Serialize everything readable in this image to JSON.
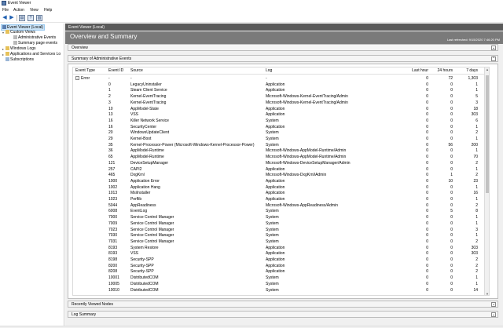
{
  "window": {
    "title": "Event Viewer"
  },
  "menu": [
    "File",
    "Action",
    "View",
    "Help"
  ],
  "tree": {
    "root": "Event Viewer (Local)",
    "custom_views": "Custom Views",
    "admin_events": "Administrative Events",
    "summary_events": "Summary page events",
    "windows_logs": "Windows Logs",
    "apps_services": "Applications and Services Lo",
    "subscriptions": "Subscriptions"
  },
  "main": {
    "header": "Event Viewer (Local)",
    "title": "Overview and Summary",
    "last_refreshed": "Last refreshed: 9/15/2020 7:46:20 PM",
    "sections": {
      "overview": "Overview",
      "admin_summary": "Summary of Administrative Events",
      "recent_nodes": "Recently Viewed Nodes",
      "log_summary": "Log Summary"
    }
  },
  "table": {
    "columns": {
      "type": "Event Type",
      "id": "Event ID",
      "source": "Source",
      "log": "Log",
      "last_hour": "Last hour",
      "h24": "24 hours",
      "d7": "7 days"
    },
    "group_row": {
      "expander": "−",
      "type": "Error",
      "id": "-",
      "source": "-",
      "log": "-",
      "last_hour": "0",
      "h24": "72",
      "d7": "1,303"
    },
    "rows": [
      [
        "0",
        "LegacyUninstaller",
        "Application",
        "0",
        "0",
        "1"
      ],
      [
        "1",
        "Steam Client Service",
        "Application",
        "0",
        "0",
        "1"
      ],
      [
        "2",
        "Kernel-EventTracing",
        "Microsoft-Windows-Kernel-EventTracing/Admin",
        "0",
        "0",
        "5"
      ],
      [
        "3",
        "Kernel-EventTracing",
        "Microsoft-Windows-Kernel-EventTracing/Admin",
        "0",
        "0",
        "3"
      ],
      [
        "10",
        "AppModel-State",
        "Application",
        "0",
        "0",
        "18"
      ],
      [
        "13",
        "VSS",
        "Application",
        "0",
        "0",
        "303"
      ],
      [
        "16",
        "Killer Network Service",
        "System",
        "0",
        "0",
        "6"
      ],
      [
        "16",
        "SecurityCenter",
        "Application",
        "0",
        "0",
        "1"
      ],
      [
        "20",
        "WindowsUpdateClient",
        "System",
        "0",
        "0",
        "2"
      ],
      [
        "29",
        "Kernel-Boot",
        "System",
        "0",
        "0",
        "1"
      ],
      [
        "35",
        "Kernel-Processor-Power (Microsoft-Windows-Kernel-Processor-Power)",
        "System",
        "0",
        "56",
        "200"
      ],
      [
        "36",
        "AppModel-Runtime",
        "Microsoft-Windows-AppModel-Runtime/Admin",
        "0",
        "0",
        "1"
      ],
      [
        "65",
        "AppModel-Runtime",
        "Microsoft-Windows-AppModel-Runtime/Admin",
        "0",
        "0",
        "70"
      ],
      [
        "121",
        "DeviceSetupManager",
        "Microsoft-Windows-DeviceSetupManager/Admin",
        "0",
        "0",
        "2"
      ],
      [
        "257",
        "CAPI2",
        "Application",
        "0",
        "0",
        "1"
      ],
      [
        "465",
        "DxgKrnl",
        "Microsoft-Windows-DxgKrnl/Admin",
        "0",
        "1",
        "2"
      ],
      [
        "1000",
        "Application Error",
        "Application",
        "0",
        "10",
        "23"
      ],
      [
        "1002",
        "Application Hang",
        "Application",
        "0",
        "0",
        "1"
      ],
      [
        "1013",
        "MsiInstaller",
        "Application",
        "0",
        "0",
        "16"
      ],
      [
        "1023",
        "Perflib",
        "Application",
        "0",
        "0",
        "1"
      ],
      [
        "5044",
        "AppReadiness",
        "Microsoft-Windows-AppReadiness/Admin",
        "0",
        "0",
        "2"
      ],
      [
        "6008",
        "EventLog",
        "System",
        "0",
        "5",
        "8"
      ],
      [
        "7000",
        "Service Control Manager",
        "System",
        "0",
        "0",
        "1"
      ],
      [
        "7009",
        "Service Control Manager",
        "System",
        "0",
        "0",
        "1"
      ],
      [
        "7023",
        "Service Control Manager",
        "System",
        "0",
        "0",
        "3"
      ],
      [
        "7030",
        "Service Control Manager",
        "System",
        "0",
        "0",
        "1"
      ],
      [
        "7031",
        "Service Control Manager",
        "System",
        "0",
        "0",
        "2"
      ],
      [
        "8193",
        "System Restore",
        "Application",
        "0",
        "0",
        "303"
      ],
      [
        "8193",
        "VSS",
        "Application",
        "0",
        "0",
        "303"
      ],
      [
        "8198",
        "Security-SPP",
        "Application",
        "0",
        "0",
        "2"
      ],
      [
        "8200",
        "Security-SPP",
        "Application",
        "0",
        "0",
        "2"
      ],
      [
        "8208",
        "Security-SPP",
        "Application",
        "0",
        "0",
        "2"
      ],
      [
        "10001",
        "DistributedCOM",
        "System",
        "0",
        "0",
        "1"
      ],
      [
        "10005",
        "DistributedCOM",
        "System",
        "0",
        "0",
        "1"
      ],
      [
        "10010",
        "DistributedCOM",
        "System",
        "0",
        "0",
        "14"
      ]
    ]
  }
}
